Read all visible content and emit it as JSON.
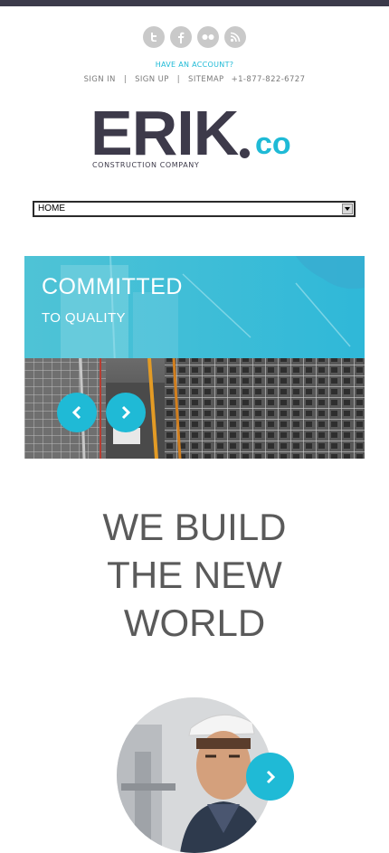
{
  "header": {
    "social_icons": [
      "twitter-icon",
      "facebook-icon",
      "flickr-icon",
      "rss-icon"
    ],
    "have_account": "HAVE AN ACCOUNT?",
    "nav": {
      "sign_in": "SIGN IN",
      "sign_up": "SIGN UP",
      "sitemap": "SITEMAP",
      "phone": "+1-877-822-6727",
      "separator": "|"
    }
  },
  "logo": {
    "main": "ERIK",
    "suffix": "co",
    "tagline": "CONSTRUCTION COMPANY"
  },
  "menu_select": {
    "value": "HOME"
  },
  "slider": {
    "title": "COMMITTED",
    "subtitle": "TO QUALITY",
    "prev_icon": "chevron-left-icon",
    "next_icon": "chevron-right-icon"
  },
  "headline": {
    "line1": "WE BUILD",
    "line2": "THE NEW",
    "line3": "WORLD"
  },
  "colors": {
    "accent": "#1fbad6",
    "dark": "#3d3a4a",
    "text_gray": "#5a5a5a",
    "icon_gray": "#c9c9c9"
  }
}
